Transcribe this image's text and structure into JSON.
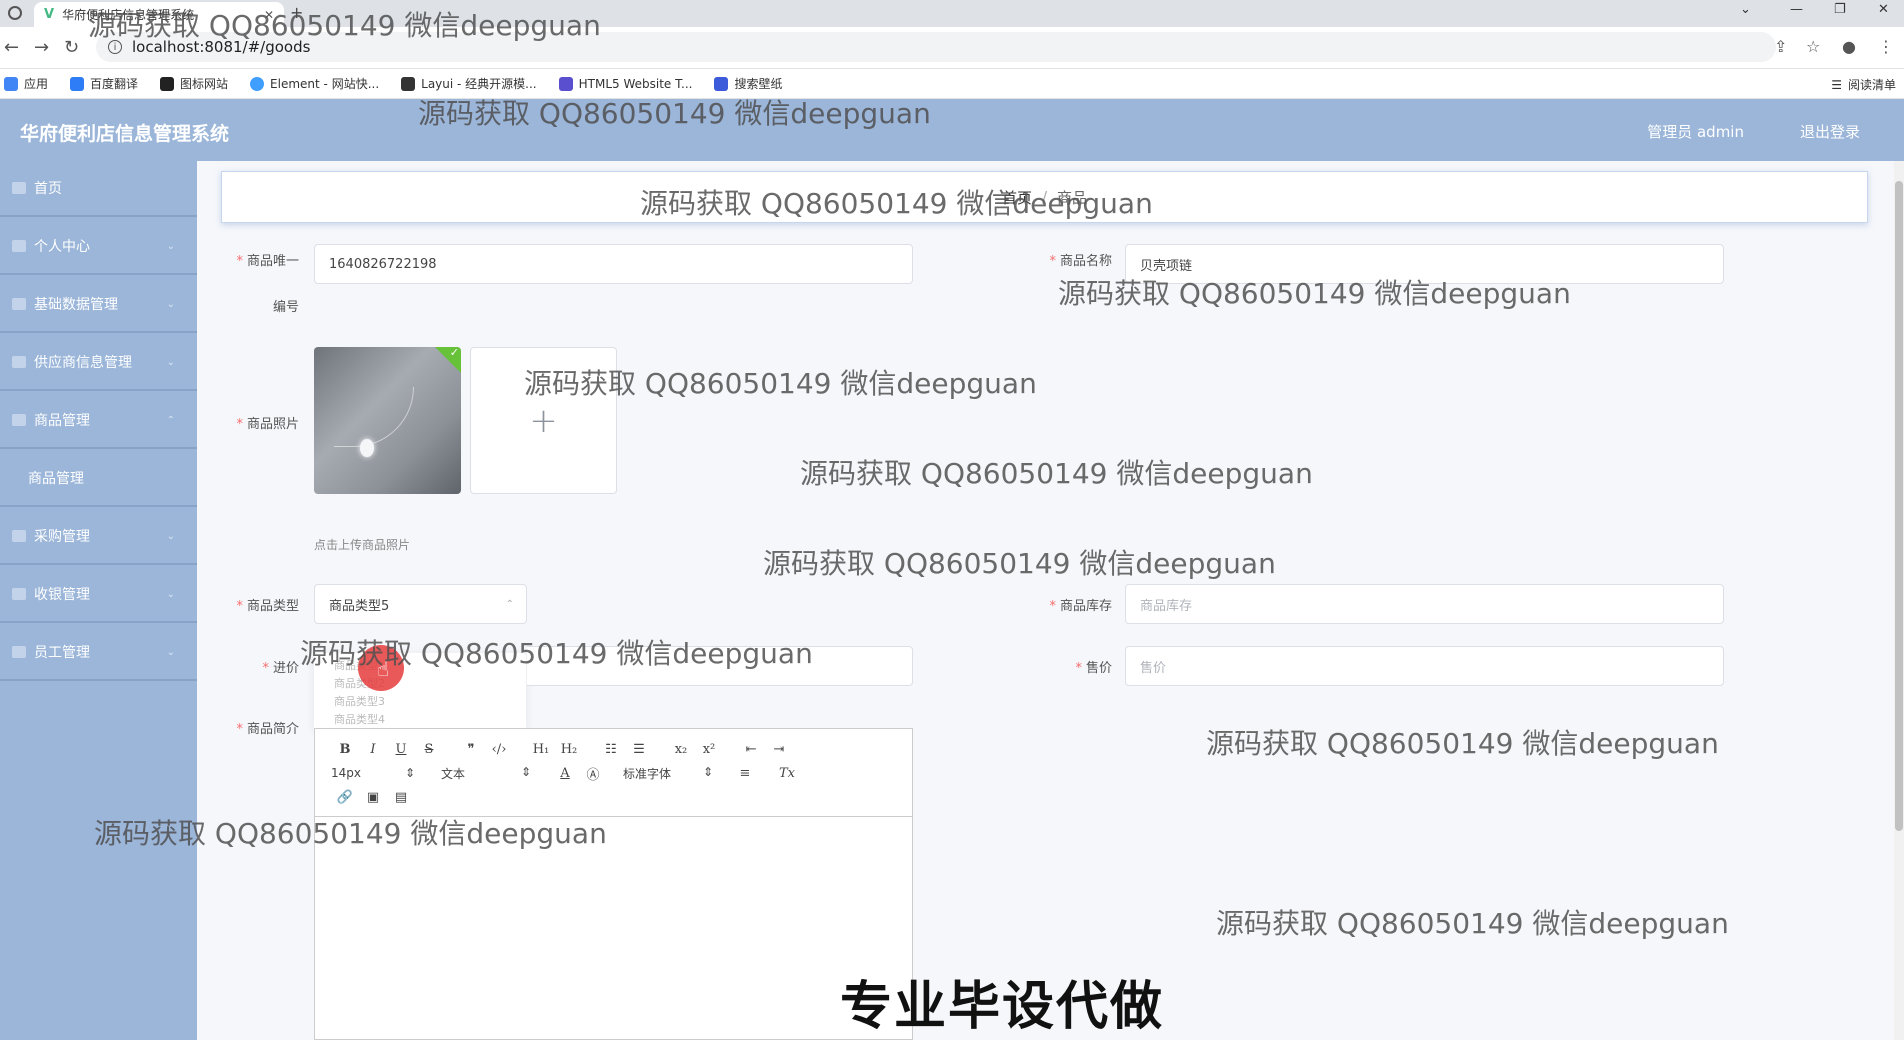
{
  "browser": {
    "tab_title": "华府便利店信息管理系统",
    "url": "localhost:8081/#/goods",
    "bookmarks": [
      {
        "label": "应用",
        "color": "#4285f4"
      },
      {
        "label": "百度翻译",
        "color": "#2e7cf6"
      },
      {
        "label": "图标网站",
        "color": "#222222"
      },
      {
        "label": "Element - 网站快...",
        "color": "#409eff"
      },
      {
        "label": "Layui - 经典开源模...",
        "color": "#333333"
      },
      {
        "label": "HTML5 Website T...",
        "color": "#5a4fcf"
      },
      {
        "label": "搜索壁纸",
        "color": "#3b5bdb"
      }
    ],
    "reading_list": "阅读清单"
  },
  "header": {
    "title": "华府便利店信息管理系统",
    "admin": "管理员 admin",
    "logout": "退出登录"
  },
  "sidebar": {
    "items": [
      {
        "label": "首页"
      },
      {
        "label": "个人中心"
      },
      {
        "label": "基础数据管理"
      },
      {
        "label": "供应商信息管理"
      },
      {
        "label": "商品管理"
      },
      {
        "label": "商品管理"
      },
      {
        "label": "采购管理"
      },
      {
        "label": "收银管理"
      },
      {
        "label": "员工管理"
      }
    ]
  },
  "breadcrumb": {
    "home": "首页",
    "current": "商品"
  },
  "form": {
    "goods_id_label": "商品唯一",
    "goods_id_label2": "编号",
    "goods_id_value": "1640826722198",
    "goods_name_label": "商品名称",
    "goods_name_value": "贝壳项链",
    "photo_label": "商品照片",
    "upload_tip": "点击上传商品照片",
    "goods_type_label": "商品类型",
    "goods_type_value": "商品类型5",
    "stock_label": "商品库存",
    "stock_placeholder": "商品库存",
    "purchase_price_label": "进价",
    "sale_price_label": "售价",
    "sale_price_placeholder": "售价",
    "intro_label": "商品简介",
    "type_options": [
      "商品类型1",
      "商品类型2",
      "商品类型3",
      "商品类型4"
    ]
  },
  "editor": {
    "font_size": "14px",
    "text_type": "文本",
    "font_family": "标准字体"
  },
  "overlay": {
    "watermark": "源码获取 QQ86050149 微信deepguan",
    "caption": "专业毕设代做"
  }
}
